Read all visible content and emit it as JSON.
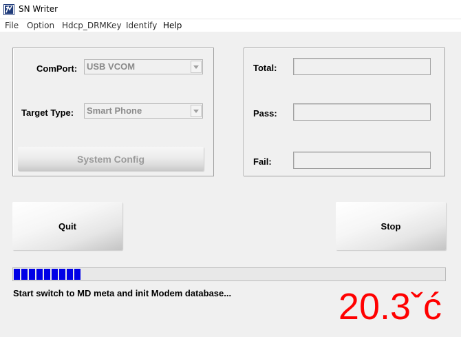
{
  "window": {
    "title": "SN Writer"
  },
  "menu": {
    "items": [
      "File",
      "Option",
      "Hdcp_DRMKey",
      "Identify",
      "Help"
    ]
  },
  "settings": {
    "comport_label": "ComPort:",
    "comport_value": "USB VCOM",
    "target_type_label": "Target Type:",
    "target_type_value": "Smart Phone",
    "system_config_label": "System Config"
  },
  "counters": {
    "total_label": "Total:",
    "total_value": "",
    "pass_label": "Pass:",
    "pass_value": "",
    "fail_label": "Fail:",
    "fail_value": ""
  },
  "actions": {
    "quit_label": "Quit",
    "stop_label": "Stop"
  },
  "progress": {
    "segments": 9,
    "fraction": 0.15,
    "color": "#0000e6"
  },
  "status": {
    "message": "Start switch to MD meta and init Modem database...",
    "temperature": "20.3ˇć",
    "temperature_color": "#ff0000"
  }
}
